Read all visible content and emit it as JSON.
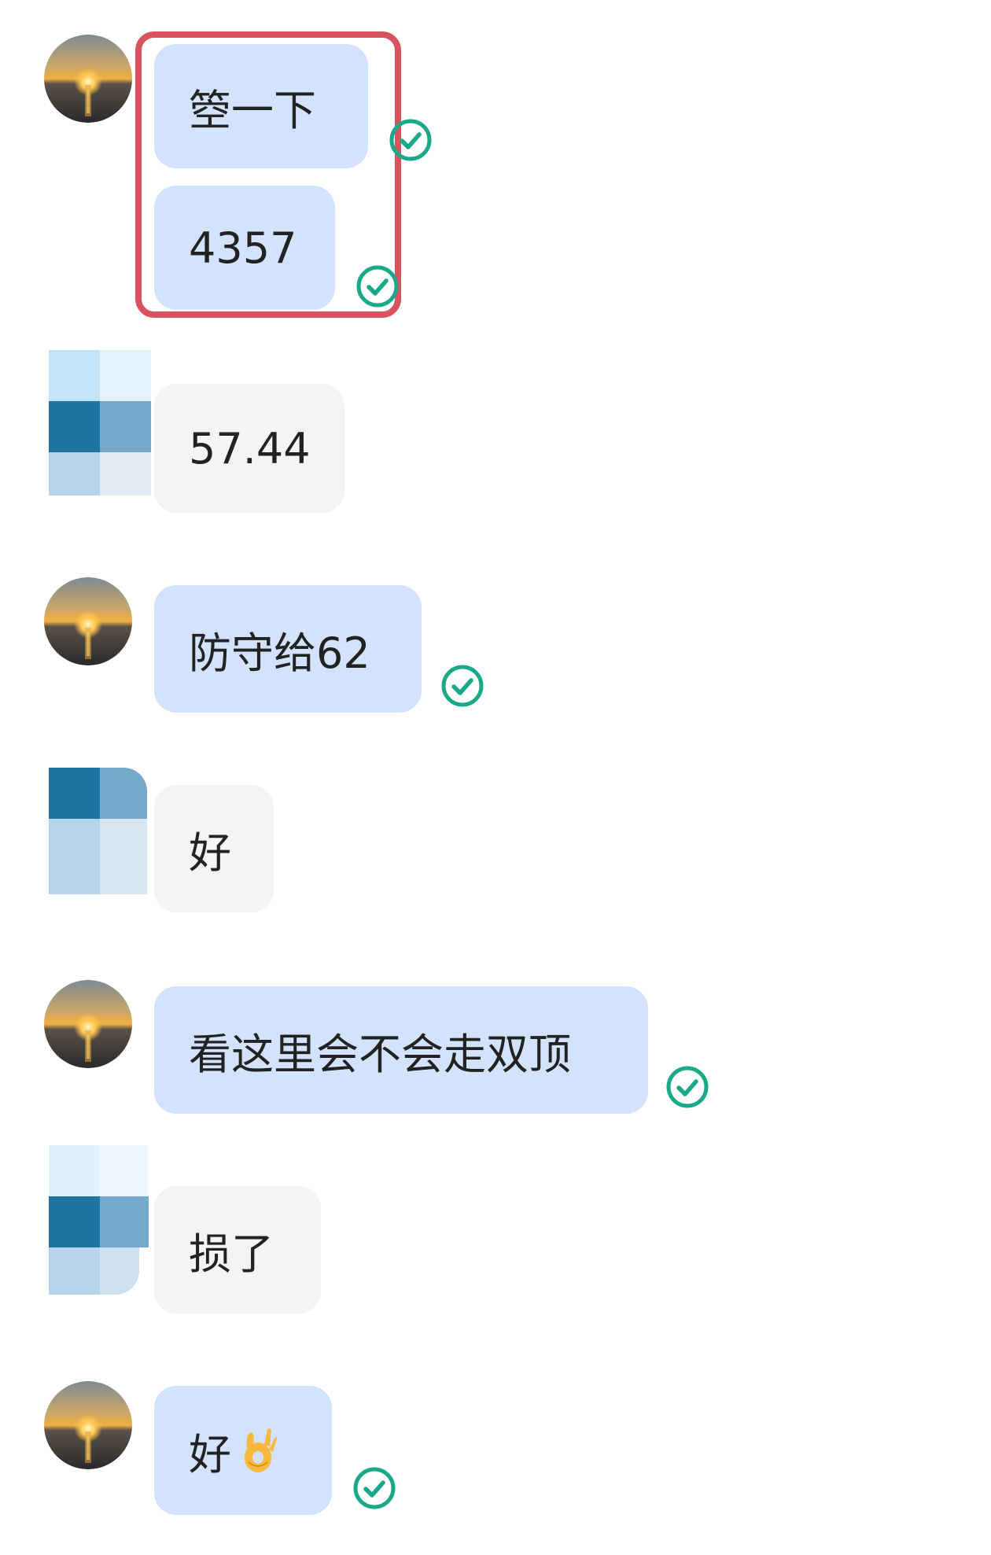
{
  "conversation": {
    "messages": [
      {
        "sender": "me",
        "text": "箜一下",
        "delivered": true
      },
      {
        "sender": "me",
        "text": "4357",
        "delivered": true
      },
      {
        "sender": "other",
        "text": "57.44"
      },
      {
        "sender": "me",
        "text": "防守给62",
        "delivered": true
      },
      {
        "sender": "other",
        "text": "好"
      },
      {
        "sender": "me",
        "text": "看这里会不会走双顶",
        "delivered": true
      },
      {
        "sender": "other",
        "text": "损了"
      },
      {
        "sender": "me",
        "text": "好",
        "emoji": "ok-hand-emoji",
        "delivered": true
      }
    ]
  },
  "colors": {
    "my_bubble": "#d4e3fd",
    "other_bubble": "#f3f4f6",
    "check_icon": "#1aa88a",
    "highlight_border": "#d9535f"
  },
  "icons": {
    "delivered": "check-circle-icon",
    "my_avatar": "sunset-avatar",
    "other_avatar": "pixelated-avatar"
  }
}
